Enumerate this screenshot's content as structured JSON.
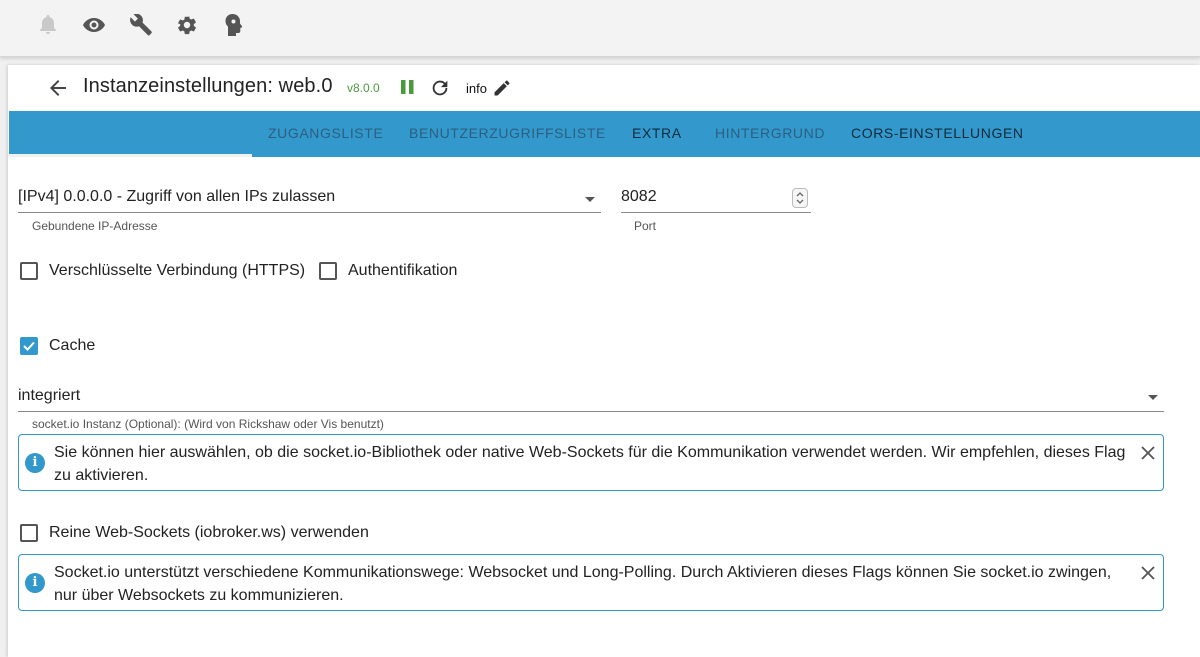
{
  "topbar": {
    "icons": [
      "bell-icon",
      "eye-icon",
      "wrench-icon",
      "gear-icon",
      "expert-head-icon"
    ]
  },
  "header": {
    "title": "Instanzeinstellungen: web.0",
    "version": "v8.0.0",
    "info_label": "info"
  },
  "tabs": [
    {
      "label": "Zugangsliste"
    },
    {
      "label": "Benutzerzugriffsliste"
    },
    {
      "label": "Extra"
    },
    {
      "label": "Hintergrund"
    },
    {
      "label": "CORS-Einstellungen"
    }
  ],
  "form": {
    "bind_ip": {
      "value": "[IPv4] 0.0.0.0 - Zugriff von allen IPs zulassen",
      "helper": "Gebundene IP-Adresse"
    },
    "port": {
      "value": "8082",
      "helper": "Port"
    },
    "https": {
      "label": "Verschlüsselte Verbindung (HTTPS)",
      "checked": false
    },
    "auth": {
      "label": "Authentifikation",
      "checked": false
    },
    "cache": {
      "label": "Cache",
      "checked": true
    },
    "socketio": {
      "value": "integriert",
      "helper": "socket.io Instanz (Optional): (Wird von Rickshaw oder Vis benutzt)"
    },
    "info1": "Sie können hier auswählen, ob die socket.io-Bibliothek oder native Web-Sockets für die Kommunikation verwendet werden. Wir empfehlen, dieses Flag zu aktivieren.",
    "pure_ws": {
      "label": "Reine Web-Sockets (iobroker.ws) verwenden",
      "checked": false
    },
    "info2": "Socket.io unterstützt verschiedene Kommunikationswege: Websocket und Long-Polling. Durch Aktivieren dieses Flags können Sie socket.io zwingen, nur über Websockets zu kommunizieren."
  },
  "colors": {
    "accent": "#3399cc",
    "version_green": "#4a9a3c"
  }
}
